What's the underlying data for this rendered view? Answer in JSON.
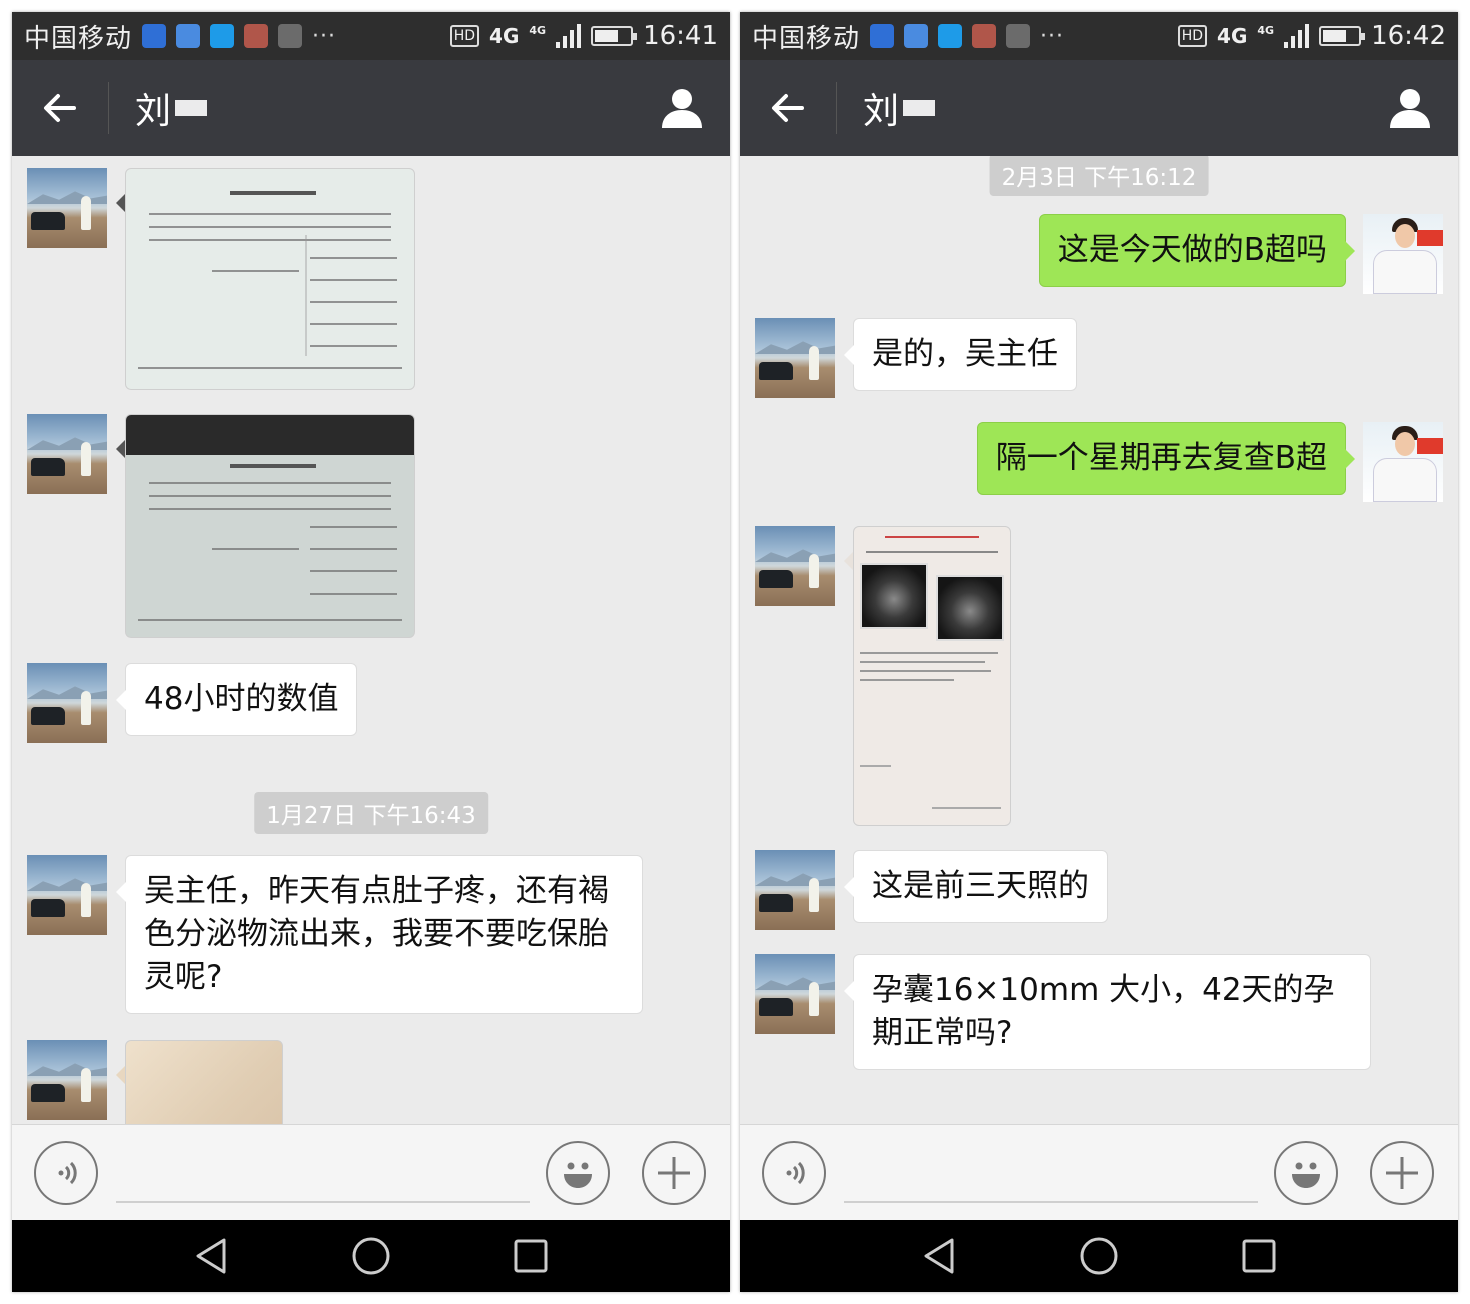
{
  "left": {
    "status": {
      "carrier": "中国移动",
      "dots": "···",
      "hd": "HD",
      "network": "4G",
      "network_small": "4G",
      "time": "16:41"
    },
    "header": {
      "title": "刘"
    },
    "timestamp": "1月27日 下午16:43",
    "messages": {
      "m3": "48小时的数值",
      "m4": "吴主任，昨天有点肚子疼，还有褐色分泌物流出来，我要不要吃保胎灵呢?"
    }
  },
  "right": {
    "status": {
      "carrier": "中国移动",
      "dots": "···",
      "hd": "HD",
      "network": "4G",
      "network_small": "4G",
      "time": "16:42"
    },
    "header": {
      "title": "刘"
    },
    "timestamp": "2月3日 下午16:12",
    "messages": {
      "m1": "这是今天做的B超吗",
      "m2": "是的，吴主任",
      "m3": "隔一个星期再去复查B超",
      "m5": "这是前三天照的",
      "m6": "孕囊16×10mm 大小，42天的孕期正常吗?"
    }
  },
  "icons": [
    "back-arrow-icon",
    "profile-icon",
    "voice-icon",
    "emoji-icon",
    "plus-icon",
    "nav-back-icon",
    "nav-home-icon",
    "nav-recents-icon"
  ]
}
